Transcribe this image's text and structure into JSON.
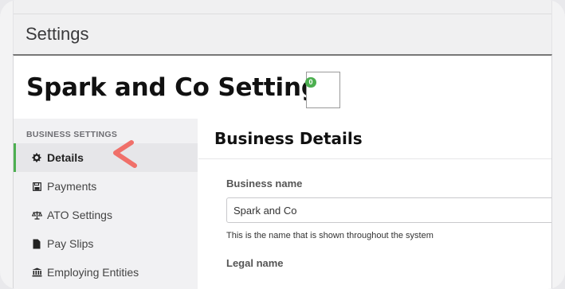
{
  "app": {
    "title": "Settings"
  },
  "page": {
    "title": "Spark and Co Settings",
    "notification_count": "0"
  },
  "sidebar": {
    "header": "BUSINESS SETTINGS",
    "items": [
      {
        "label": "Details",
        "icon": "gear-icon",
        "active": true
      },
      {
        "label": "Payments",
        "icon": "save-icon",
        "active": false
      },
      {
        "label": "ATO Settings",
        "icon": "balance-scale-icon",
        "active": false
      },
      {
        "label": "Pay Slips",
        "icon": "document-icon",
        "active": false
      },
      {
        "label": "Employing Entities",
        "icon": "bank-icon",
        "active": false
      }
    ]
  },
  "content": {
    "title": "Business Details",
    "business_name": {
      "label": "Business name",
      "value": "Spark and Co",
      "help": "This is the name that is shown throughout the system"
    },
    "legal_name": {
      "label": "Legal name"
    }
  },
  "colors": {
    "accent": "#4caf50",
    "pointer": "#f0706a"
  }
}
